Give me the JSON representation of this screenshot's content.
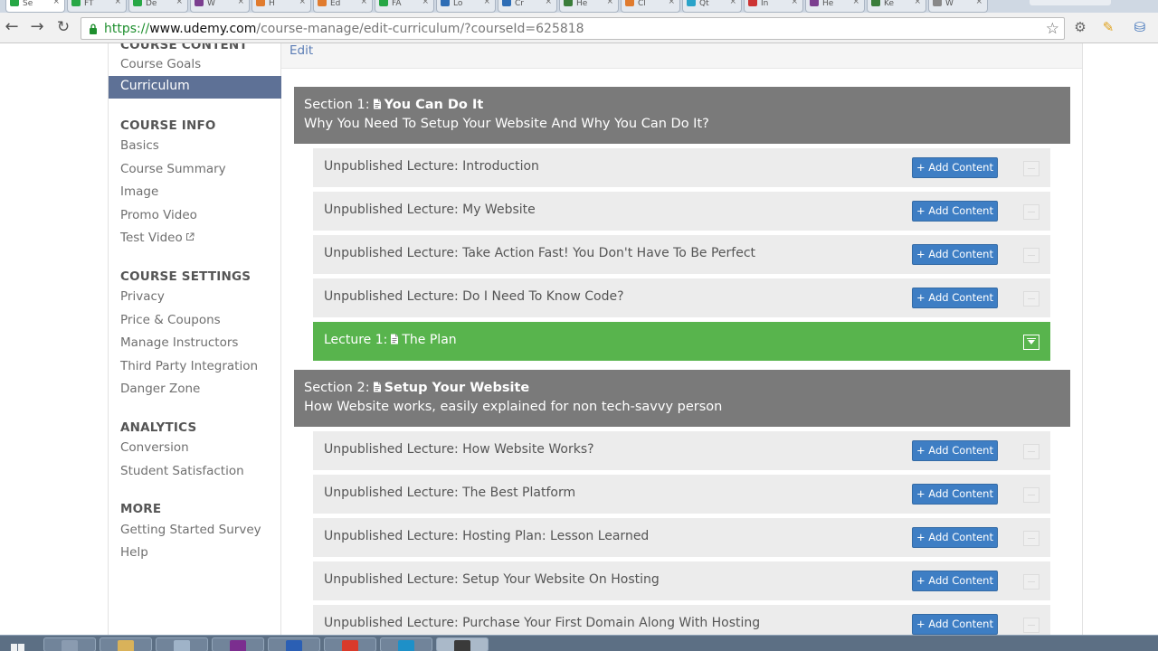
{
  "browser": {
    "tabs": [
      {
        "label": "Se",
        "color": "#27a745",
        "active": true
      },
      {
        "label": "FT",
        "color": "#27a745"
      },
      {
        "label": "De",
        "color": "#27a745"
      },
      {
        "label": "W",
        "color": "#7b3e8f"
      },
      {
        "label": "H",
        "color": "#e07b2e"
      },
      {
        "label": "Ed",
        "color": "#e07b2e"
      },
      {
        "label": "FA",
        "color": "#27a745"
      },
      {
        "label": "Lo",
        "color": "#2d6db5"
      },
      {
        "label": "Cr",
        "color": "#2d6db5"
      },
      {
        "label": "He",
        "color": "#3a7d3a"
      },
      {
        "label": "Cl",
        "color": "#e07b2e"
      },
      {
        "label": "Qt",
        "color": "#2aa3c9"
      },
      {
        "label": "In",
        "color": "#cc3333"
      },
      {
        "label": "He",
        "color": "#7b3e8f"
      },
      {
        "label": "Ke",
        "color": "#3a7d3a"
      },
      {
        "label": "W",
        "color": "#888888"
      }
    ],
    "url_scheme": "https://",
    "url_host": "www.udemy.com",
    "url_path": "/course-manage/edit-curriculum/?courseId=625818"
  },
  "sidebar": {
    "course_content_heading": "COURSE CONTENT",
    "course_goals": "Course Goals",
    "curriculum": "Curriculum",
    "course_info_heading": "COURSE INFO",
    "basics": "Basics",
    "course_summary": "Course Summary",
    "image": "Image",
    "promo_video": "Promo Video",
    "test_video": "Test Video",
    "course_settings_heading": "COURSE SETTINGS",
    "privacy": "Privacy",
    "price_coupons": "Price & Coupons",
    "manage_instructors": "Manage Instructors",
    "third_party": "Third Party Integration",
    "danger_zone": "Danger Zone",
    "analytics_heading": "ANALYTICS",
    "conversion": "Conversion",
    "student_satisfaction": "Student Satisfaction",
    "more_heading": "MORE",
    "getting_started": "Getting Started Survey",
    "help": "Help"
  },
  "main": {
    "edit_label": "Edit",
    "add_content_label": "+ Add Content",
    "sections": [
      {
        "prefix": "Section 1:",
        "title": "You Can Do It",
        "subtitle": "Why You Need To Setup Your Website And Why You Can Do It?",
        "lectures": [
          {
            "title": "Unpublished Lecture: Introduction"
          },
          {
            "title": "Unpublished Lecture: My Website"
          },
          {
            "title": "Unpublished Lecture: Take Action Fast! You Don't Have To Be Perfect"
          },
          {
            "title": "Unpublished Lecture: Do I Need To Know Code?"
          },
          {
            "prefix": "Lecture 1:",
            "title": "The Plan",
            "published": true
          }
        ]
      },
      {
        "prefix": "Section 2:",
        "title": "Setup Your Website",
        "subtitle": "How Website works, easily explained for non tech-savvy person",
        "lectures": [
          {
            "title": "Unpublished Lecture: How Website Works?"
          },
          {
            "title": "Unpublished Lecture: The Best Platform"
          },
          {
            "title": "Unpublished Lecture: Hosting Plan: Lesson Learned"
          },
          {
            "title": "Unpublished Lecture: Setup Your Website On Hosting"
          },
          {
            "title": "Unpublished Lecture: Purchase Your First Domain Along With Hosting"
          }
        ]
      }
    ]
  },
  "taskbar": {
    "items": [
      {
        "color": "#8a9bb0"
      },
      {
        "color": "#d9b25a"
      },
      {
        "color": "#9fb3c8"
      },
      {
        "color": "#7b2e8f"
      },
      {
        "color": "#2b5fb4"
      },
      {
        "color": "#d93a2b"
      },
      {
        "color": "#1e90c8"
      },
      {
        "color": "#3a3a3a",
        "active": true
      }
    ]
  }
}
